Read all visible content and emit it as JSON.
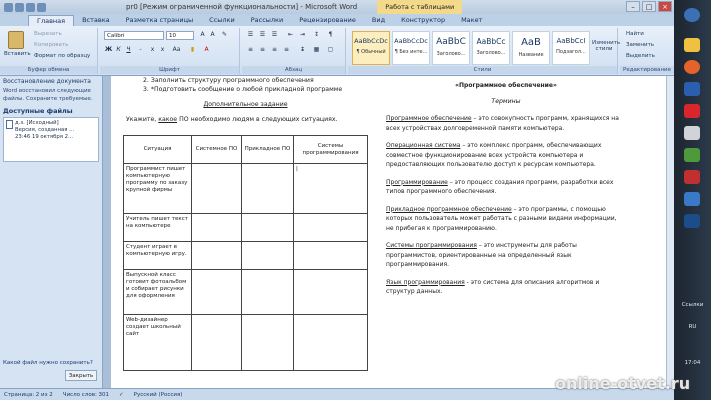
{
  "window": {
    "title": "pr0 [Режим ограниченной функциональности] - Microsoft Word",
    "context_tab": "Работа с таблицами",
    "minimize": "–",
    "maximize": "□",
    "close": "×"
  },
  "tabs": [
    "Главная",
    "Вставка",
    "Разметка страницы",
    "Ссылки",
    "Рассылки",
    "Рецензирование",
    "Вид",
    "Конструктор",
    "Макет"
  ],
  "ribbon": {
    "clipboard": {
      "paste": "Вставить",
      "cut": "Вырезать",
      "copy": "Копировать",
      "format": "Формат по образцу",
      "label": "Буфер обмена"
    },
    "font": {
      "name": "Calibri",
      "size": "10",
      "label": "Шрифт"
    },
    "paragraph": {
      "label": "Абзац"
    },
    "styles": {
      "label": "Стили",
      "items": [
        {
          "sample": "AaBbCcDc",
          "name": "¶ Обычный"
        },
        {
          "sample": "AaBbCcDc",
          "name": "¶ Без инте..."
        },
        {
          "sample": "AaBbC",
          "name": "Заголово..."
        },
        {
          "sample": "AaBbCc",
          "name": "Заголово..."
        },
        {
          "sample": "AaB",
          "name": "Название"
        },
        {
          "sample": "AaBbCcI",
          "name": "Подзагол..."
        }
      ],
      "change": "Изменить стили"
    },
    "editing": {
      "find": "Найти",
      "replace": "Заменить",
      "select": "Выделить",
      "label": "Редактирование"
    }
  },
  "left_pane": {
    "title": "Восстановление документа",
    "text": "Word восстановил следующие файлы. Сохраните требуемые.",
    "available": "Доступные файлы",
    "file": {
      "line1": "д.з. [Исходный]",
      "line2": "Версия, созданная ...",
      "line3": "23:46 19 октября 2..."
    },
    "question": "Какой файл нужно сохранить?",
    "close": "Закрыть"
  },
  "doc": {
    "list": [
      "2.   Заполнить структуру программного обеспечения",
      "3.   *Подготовить сообщение о любой прикладной программе"
    ],
    "extra_title": "Дополнительное задание",
    "task_pre": "Укажите, ",
    "task_underlined": "какое",
    "task_post": " ПО необходимо людям в следующих ситуациях.",
    "table": {
      "headers": [
        "Ситуация",
        "Системное ПО",
        "Прикладное ПО",
        "Системы программирования"
      ],
      "rows": [
        "Программист пишет компьютерную программу по заказу крупной фирмы",
        "Учитель пишет текст на компьютере",
        "Студент играет в компьютерную игру.",
        "Выпускной класс готовит фотоальбом и собирает рисунки для оформления",
        "Web-дизайнер создает школьный сайт"
      ]
    },
    "right": {
      "title": "«Программное обеспечение»",
      "subtitle": "Термины",
      "paragraphs": [
        {
          "term": "Программное обеспечение",
          "text": " – это совокупность программ, хранящихся на всех устройствах долговременной памяти компьютера."
        },
        {
          "term": "Операционная система",
          "text": " – это комплекс программ, обеспечивающих совместное функционирование всех устройств компьютера и предоставляющих пользователю доступ к ресурсам компьютера."
        },
        {
          "term": "Программирование",
          "text": " – это процесс создания программ, разработки всех типов программного обеспечения."
        },
        {
          "term": "Прикладное программное обеспечение",
          "text": " – это программы, с помощью которых пользователь может работать с разными видами информации, не прибегая к программированию."
        },
        {
          "term": "Системы программирования",
          "text": " – это инструменты для работы программистов, ориентированные на определенный язык программирования."
        },
        {
          "term": "Язык программирования",
          "text": " - это система для описания алгоритмов и структур данных."
        }
      ]
    }
  },
  "status": {
    "page": "Страница: 2 из 2",
    "words": "Число слов: 301",
    "lang": "Русский (Россия)"
  },
  "taskbar": {
    "links": "Ссылки",
    "lang": "RU",
    "time": "17:04"
  },
  "watermark": "online-otvet.ru"
}
